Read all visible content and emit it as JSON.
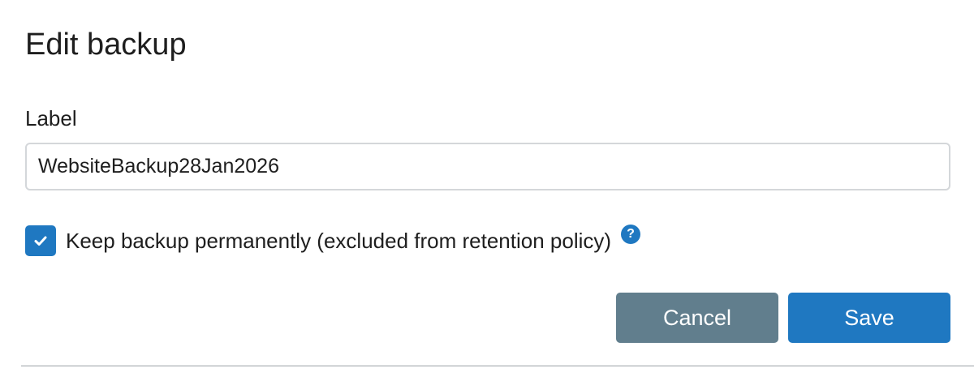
{
  "dialog": {
    "title": "Edit backup",
    "label_field": {
      "label": "Label",
      "value": "WebsiteBackup28Jan2026",
      "placeholder": ""
    },
    "keep_permanently": {
      "checked": true,
      "label": "Keep backup permanently (excluded from retention policy)",
      "help_icon": "question-circle-icon",
      "help_glyph": "?"
    },
    "buttons": {
      "cancel_label": "Cancel",
      "save_label": "Save"
    }
  },
  "colors": {
    "primary": "#1f78c1",
    "secondary_button": "#617e8d",
    "input_border": "#d4d7da"
  }
}
